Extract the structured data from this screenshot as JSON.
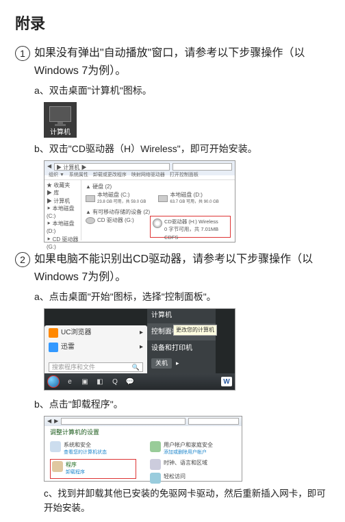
{
  "title": "附录",
  "step1": {
    "text": "如果没有弹出\"自动播放\"窗口，请参考以下步骤操作（以Windows 7为例）。",
    "a": "a、双击桌面\"计算机\"图标。",
    "icon_label": "计算机",
    "b": "b、双击\"CD驱动器（H）Wireless\"，即可开始安装。",
    "explorer": {
      "address": "▶ 计算机 ▶",
      "side": [
        "★ 收藏夹",
        "",
        "▶ 库",
        "",
        "▶ 计算机",
        "  ⯈ 本地磁盘 (C:)",
        "  ⯈ 本地磁盘 (D:)",
        "  ⯈ CD 驱动器 (G:)",
        "  ⯈ CD 驱动器 (H:) Wireless"
      ],
      "section1": "▲ 硬盘 (2)",
      "drives": [
        {
          "name": "本地磁盘 (C:)",
          "info": "23.8 GB 可用，共 59.0 GB"
        },
        {
          "name": "本地磁盘 (D:)",
          "info": "63.7 GB 可用，共 90.0 GB"
        }
      ],
      "section2": "▲ 有可移动存储的设备 (2)",
      "cd_g": "CD 驱动器 (G:)",
      "callout": {
        "line1": "CD驱动器 (H:) Wireless",
        "line2": "0 字节可用，共 7.01MB",
        "line3": "CDFS"
      }
    }
  },
  "step2": {
    "text": "如果电脑不能识别出CD驱动器，请参考以下步骤操作（以Windows 7为例）。",
    "a": "a、点击桌面\"开始\"图标，选择\"控制面板\"。",
    "start": {
      "uc": "UC浏览器",
      "xunlei": "迅雷",
      "search_ph": "搜索程序和文件",
      "computer": "计算机",
      "control": "控制面板",
      "tooltip": "更改您的计算机",
      "devices": "设备和打印机",
      "shutdown": "关机"
    },
    "b": "b、点击\"卸载程序\"。",
    "panel": {
      "heading": "调整计算机的设置",
      "items": {
        "sys": "系统和安全",
        "sys_sub": "查看您的计算机状态",
        "prog": "程序",
        "prog_sub": "卸载程序",
        "user": "用户帐户和家庭安全",
        "user_sub": "添加或删除用户帐户",
        "clock": "时钟、语言和区域",
        "access": "轻松访问"
      }
    },
    "c": "c、找到并卸载其他已安装的免驱网卡驱动，然后重新插入网卡，即可开始安装。"
  }
}
